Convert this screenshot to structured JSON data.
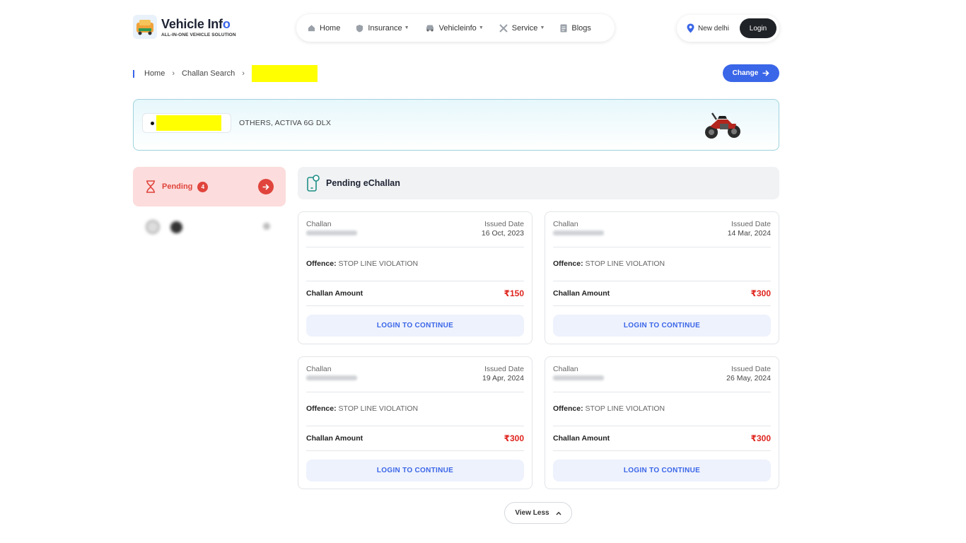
{
  "brand": {
    "name": "Vehicle Inf",
    "name_suffix": "o",
    "tagline": "ALL-IN-ONE VEHICLE SOLUTION"
  },
  "nav": {
    "items": [
      {
        "label": "Home",
        "icon": "home-icon",
        "dropdown": false
      },
      {
        "label": "Insurance",
        "icon": "shield-icon",
        "dropdown": true
      },
      {
        "label": "Vehicleinfo",
        "icon": "car-icon",
        "dropdown": true
      },
      {
        "label": "Service",
        "icon": "tools-icon",
        "dropdown": true
      },
      {
        "label": "Blogs",
        "icon": "blog-icon",
        "dropdown": false
      }
    ]
  },
  "location": {
    "city": "New delhi",
    "icon": "location-pin-icon"
  },
  "header": {
    "login_label": "Login"
  },
  "breadcrumb": {
    "items": [
      "Home",
      "Challan Search"
    ]
  },
  "change_button": {
    "label": "Change"
  },
  "vehicle": {
    "model": "OTHERS, ACTIVA 6G DLX",
    "icon": "motorcycle-icon"
  },
  "tabs": {
    "pending": {
      "label": "Pending",
      "count": "4"
    }
  },
  "section": {
    "title": "Pending eChallan",
    "icon": "phone-challan-icon"
  },
  "card_labels": {
    "challan": "Challan",
    "issued_date": "Issued Date",
    "offence": "Offence:",
    "amount": "Challan Amount",
    "cta": "LOGIN TO CONTINUE"
  },
  "challans": [
    {
      "date": "16 Oct, 2023",
      "offence": "STOP LINE VIOLATION",
      "amount": "₹150"
    },
    {
      "date": "14 Mar, 2024",
      "offence": "STOP LINE VIOLATION",
      "amount": "₹300"
    },
    {
      "date": "19 Apr, 2024",
      "offence": "STOP LINE VIOLATION",
      "amount": "₹300"
    },
    {
      "date": "26 May, 2024",
      "offence": "STOP LINE VIOLATION",
      "amount": "₹300"
    }
  ],
  "view_less": {
    "label": "View Less"
  },
  "colors": {
    "accent": "#3a66e8",
    "danger": "#e0443c",
    "amount": "#e0241e"
  }
}
